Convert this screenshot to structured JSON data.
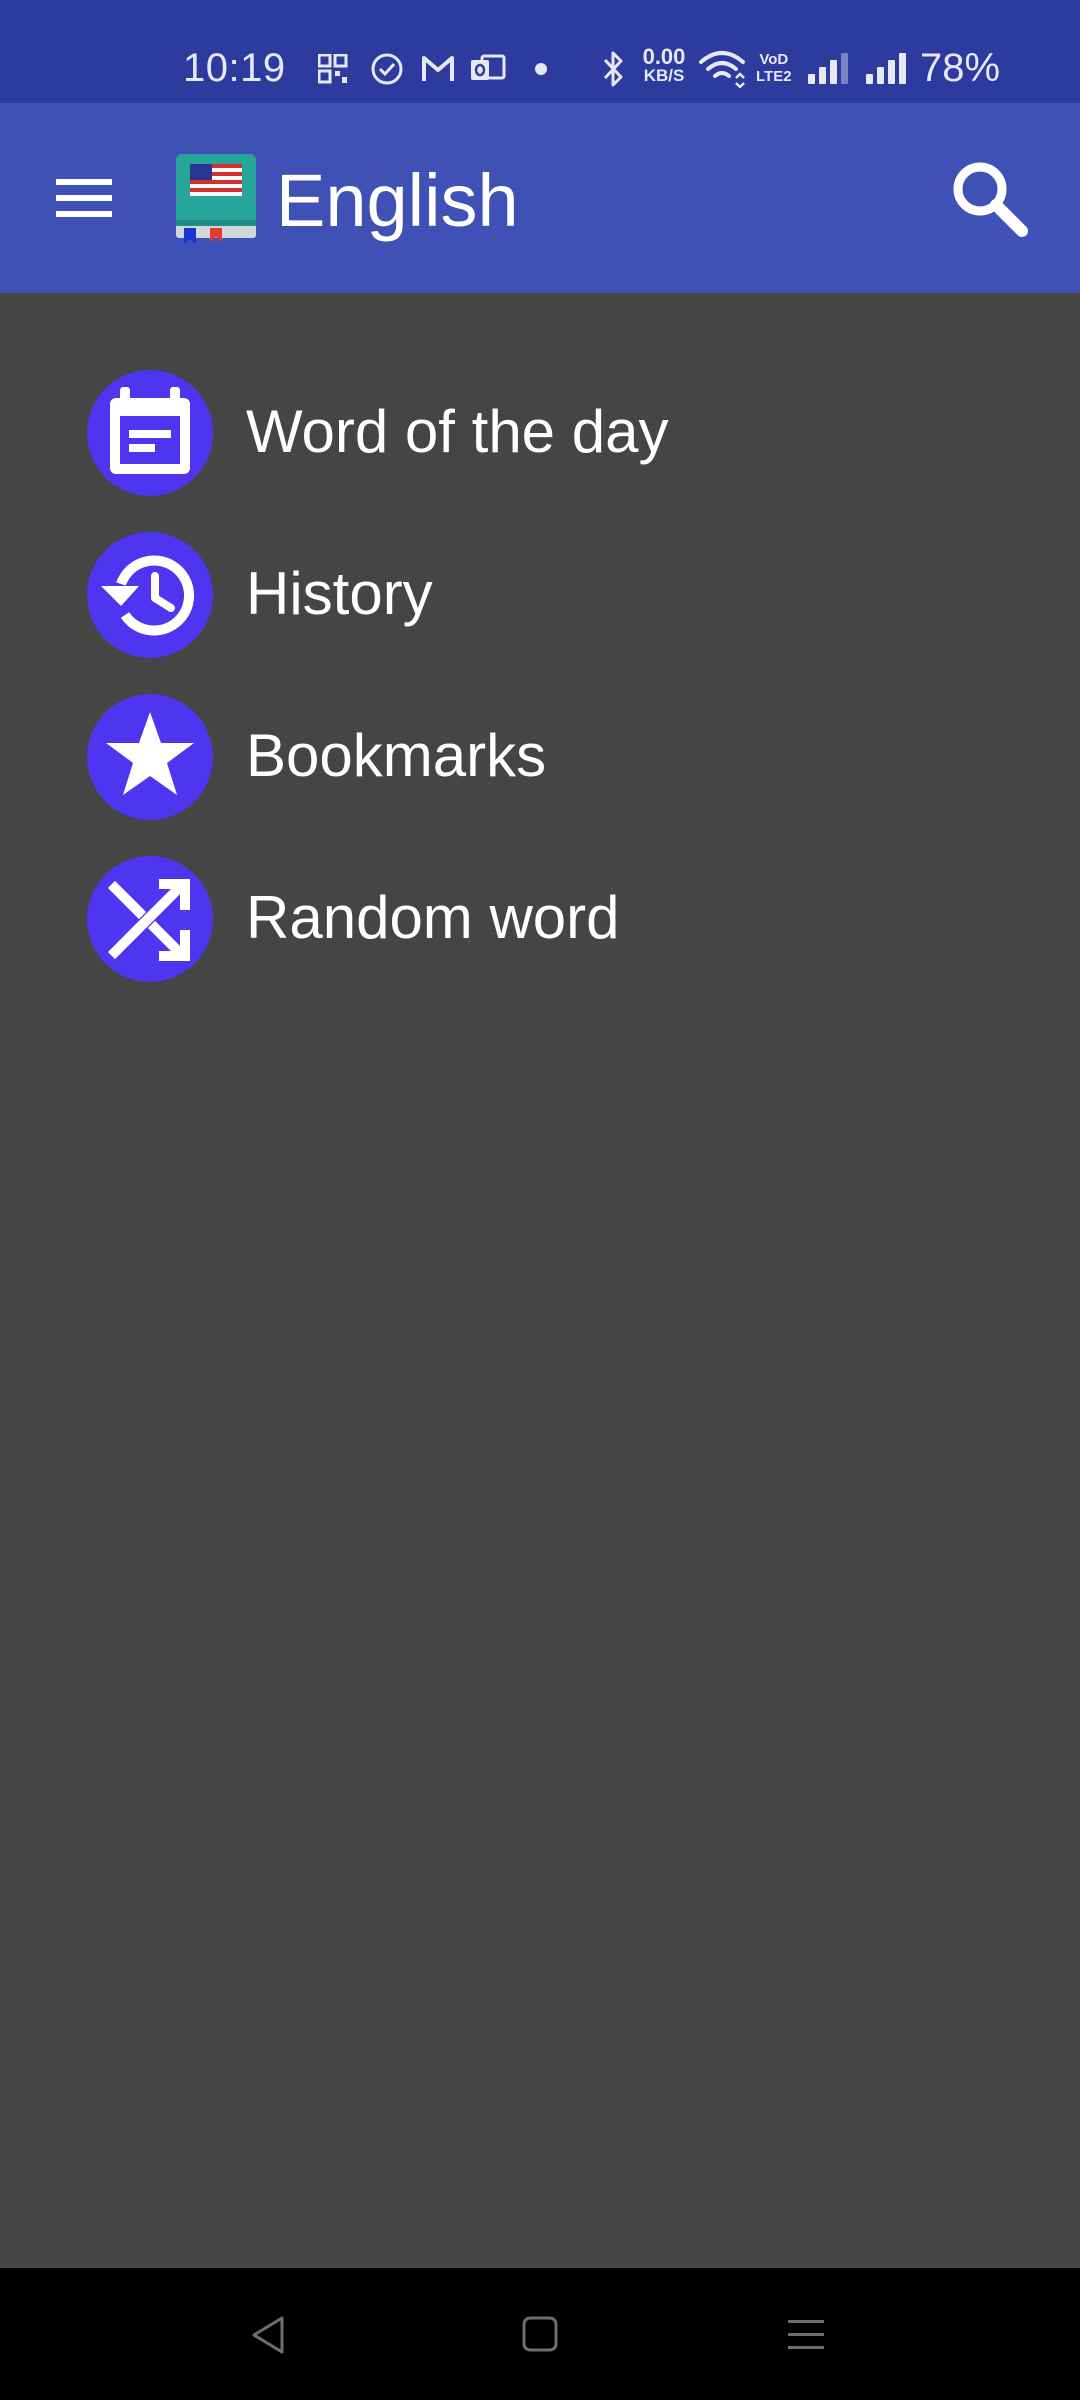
{
  "status_bar": {
    "time": "10:19",
    "net_speed_value": "0.00",
    "net_speed_unit": "KB/S",
    "volte_top": "VoD",
    "volte_bottom": "LTE2",
    "battery": "78%",
    "icons": [
      "qr-grid-icon",
      "check-circle-icon",
      "gmail-icon",
      "outlook-icon",
      "notification-dot-icon",
      "bluetooth-icon",
      "wifi-icon",
      "signal-icon",
      "signal-icon"
    ]
  },
  "app_bar": {
    "title": "English",
    "menu_icon": "hamburger-menu-icon",
    "logo_icon": "dictionary-book-flag-icon",
    "search_icon": "search-icon"
  },
  "menu": {
    "items": [
      {
        "label": "Word of the day",
        "icon": "calendar-icon"
      },
      {
        "label": "History",
        "icon": "history-clock-icon"
      },
      {
        "label": "Bookmarks",
        "icon": "star-icon"
      },
      {
        "label": "Random word",
        "icon": "shuffle-icon"
      }
    ]
  },
  "colors": {
    "status_bar": "#2d3a9e",
    "app_bar": "#3f51b5",
    "background": "#454545",
    "icon_circle": "#4f35ef",
    "nav_bar": "#000000"
  },
  "nav_bar": {
    "buttons": [
      "back-icon",
      "home-icon",
      "recents-menu-icon"
    ]
  }
}
